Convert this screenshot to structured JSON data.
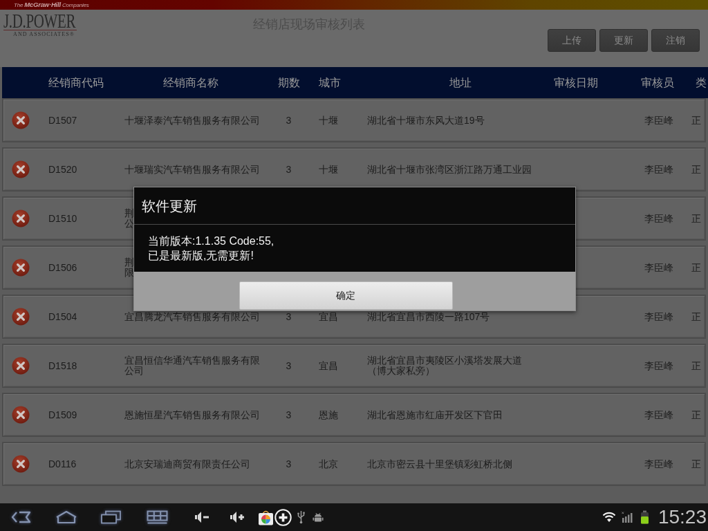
{
  "brand_bar": {
    "text": "The **McGraw·Hill** Companies"
  },
  "logo": {
    "name": "J.D.POWER",
    "subtitle": "AND ASSOCIATES®"
  },
  "header": {
    "title": "经销店现场审核列表",
    "buttons": [
      "上传",
      "更新",
      "注销"
    ]
  },
  "table": {
    "columns": [
      "经销商代码",
      "经销商名称",
      "期数",
      "城市",
      "地址",
      "审核日期",
      "审核员",
      "类"
    ],
    "rows": [
      {
        "code": "D1507",
        "name": "十堰泽泰汽车销售服务有限公司",
        "period": "3",
        "city": "十堰",
        "address": "湖北省十堰市东风大道19号",
        "auditor": "李臣峰",
        "type": "正"
      },
      {
        "code": "D1520",
        "name": "十堰瑞实汽车销售服务有限公司",
        "period": "3",
        "city": "十堰",
        "address": "湖北省十堰市张湾区浙江路万通工业园",
        "auditor": "李臣峰",
        "type": "正"
      },
      {
        "code": "D1510",
        "name_fragments": [
          "荆",
          "公"
        ],
        "auditor": "李臣峰",
        "type": "正"
      },
      {
        "code": "D1506",
        "name_fragments": [
          "荆",
          "限"
        ],
        "auditor": "李臣峰",
        "type": "正"
      },
      {
        "code": "D1504",
        "name": "宜昌腾龙汽车销售服务有限公司",
        "period": "3",
        "city": "宜昌",
        "address": "湖北省宜昌市西陵一路107号",
        "auditor": "李臣峰",
        "type": "正"
      },
      {
        "code": "D1518",
        "name": "宜昌恒信华通汽车销售服务有限公司",
        "period": "3",
        "city": "宜昌",
        "address": "湖北省宜昌市夷陵区小溪塔发展大道（博大家私旁）",
        "auditor": "李臣峰",
        "type": "正"
      },
      {
        "code": "D1509",
        "name": "恩施恒星汽车销售服务有限公司",
        "period": "3",
        "city": "恩施",
        "address": "湖北省恩施市红庙开发区下官田",
        "auditor": "李臣峰",
        "type": "正"
      },
      {
        "code": "D0116",
        "name": "北京安瑞迪商贸有限责任公司",
        "period": "3",
        "city": "北京",
        "address": "北京市密云县十里堡镇彩虹桥北侧",
        "auditor": "李臣峰",
        "type": "正"
      }
    ]
  },
  "dialog": {
    "title": "软件更新",
    "message": "当前版本:1.1.35 Code:55,\n已是最新版,无需更新!",
    "buttons": [
      "确定"
    ]
  },
  "navigation_bar": {
    "time": "15:23"
  }
}
